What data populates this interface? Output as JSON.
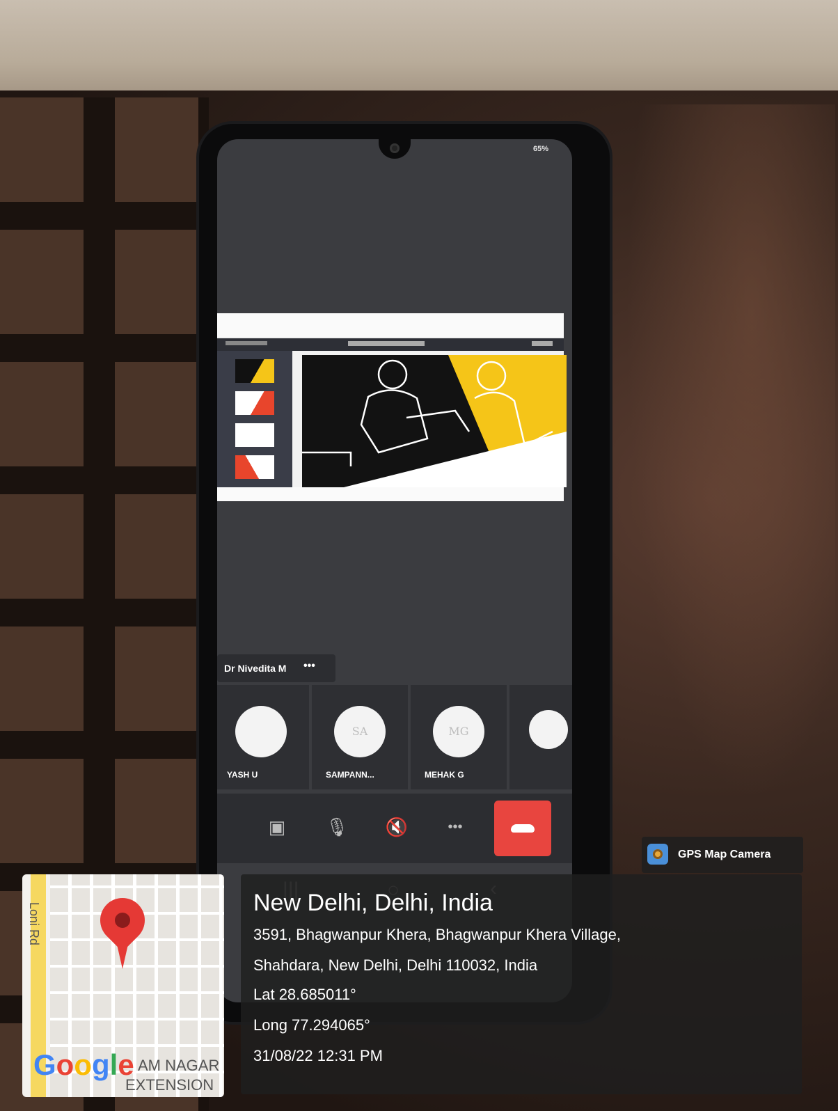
{
  "phone": {
    "battery": "65%",
    "meeting": {
      "presenter_label": "Dr Nivedita M",
      "more": "•••",
      "participants": [
        {
          "initials": "",
          "name": "YASH U"
        },
        {
          "initials": "SA",
          "name": "SAMPANN..."
        },
        {
          "initials": "MG",
          "name": "MEHAK G"
        },
        {
          "initials": "",
          "name": ""
        }
      ],
      "controls": {
        "more": "•••"
      }
    }
  },
  "overlay": {
    "app_name": "GPS Map Camera",
    "city": "New Delhi, Delhi, India",
    "address_line1": "3591, Bhagwanpur Khera, Bhagwanpur Khera Village,",
    "address_line2": "Shahdara, New Delhi, Delhi 110032, India",
    "lat": "Lat 28.685011°",
    "long": "Long 77.294065°",
    "datetime": "31/08/22 12:31 PM"
  },
  "map": {
    "road_label": "Loni Rd",
    "area_line1": "AM NAGAR",
    "area_line2": "EXTENSION",
    "pin_color": "#e53935"
  },
  "colors": {
    "hangup": "#e8453f",
    "slide_yellow": "#f5c518"
  }
}
